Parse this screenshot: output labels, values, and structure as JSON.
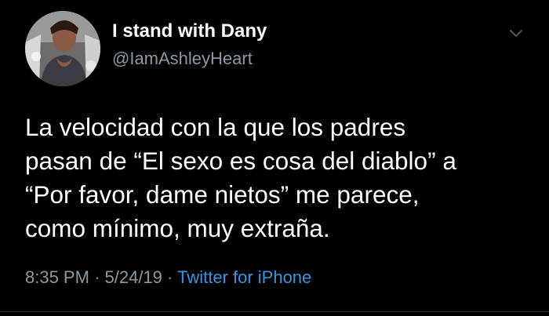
{
  "tweet": {
    "author": {
      "display_name": "I stand with Dany",
      "handle": "@IamAshleyHeart",
      "avatar_icon": "profile-photo"
    },
    "menu_icon": "chevron-down-icon",
    "text": "La velocidad con la que los padres\npasan de “El sexo es cosa del diablo” a\n“Por favor, dame nietos” me parece,\ncomo mínimo, muy extraña.",
    "time": "8:35 PM",
    "separator": "·",
    "date": "5/24/19",
    "source": "Twitter for iPhone"
  },
  "colors": {
    "background": "#000000",
    "primary_text": "#ffffff",
    "secondary_text": "#8b98a5",
    "link": "#3b94d9"
  }
}
